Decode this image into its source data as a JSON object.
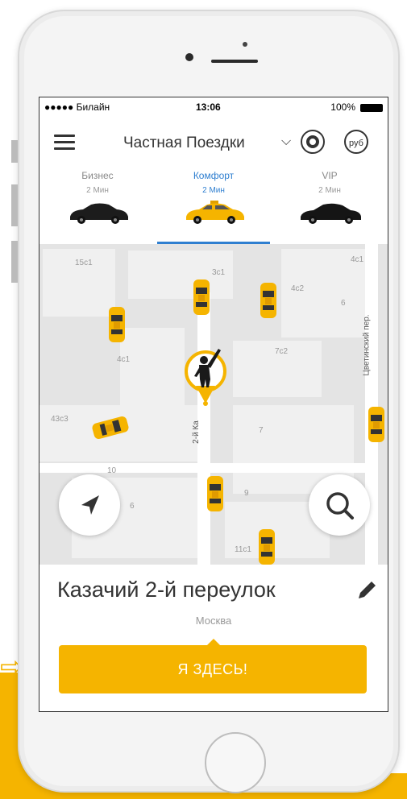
{
  "status_bar": {
    "carrier": "●●●●● Билайн",
    "time": "13:06",
    "battery": "100%"
  },
  "header": {
    "title": "Частная Поездки",
    "coupon_label": "руб"
  },
  "tariffs": [
    {
      "name": "Бизнес",
      "eta": "2 Мин"
    },
    {
      "name": "Комфорт",
      "eta": "2 Мин",
      "selected": true
    },
    {
      "name": "VIP",
      "eta": "2 Мин"
    }
  ],
  "map": {
    "labels": [
      "15с1",
      "3с1",
      "4с1",
      "4с2",
      "6",
      "4с1",
      "7с2",
      "43с3",
      "7",
      "10",
      "6",
      "9",
      "11с1"
    ],
    "street_label": "2-й Ка",
    "side_street_label": "Цветинский пер.",
    "colors": {
      "taxi": "#f5b400",
      "accent": "#2f7fd0"
    }
  },
  "address": {
    "street": "Казачий 2-й переулок",
    "city": "Москва"
  },
  "confirm_button": "Я ЗДЕСЬ!"
}
